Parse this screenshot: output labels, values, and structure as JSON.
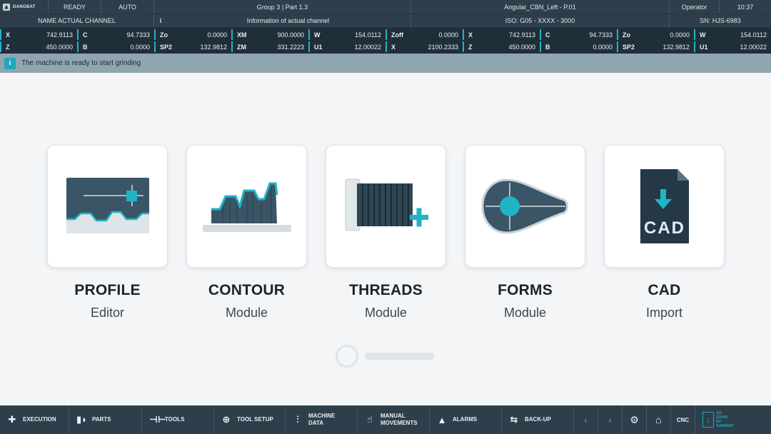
{
  "header": {
    "brand": "DANOBAT",
    "state": "READY",
    "mode": "AUTO",
    "group": "Group 3 | Part 1.3",
    "program": "Angular_CBN_Left - P.01",
    "user": "Operator",
    "time": "10:37",
    "channel_name": "NAME ACTUAL CHANNEL",
    "info_icon": "i",
    "channel_info": "Information of actual channel",
    "iso": "ISO: G05 - XXXX - 3000",
    "serial": "SN: HJS-6983"
  },
  "axes": {
    "row1": [
      {
        "label": "X",
        "value": "742.9113"
      },
      {
        "label": "C",
        "value": "94.7333"
      },
      {
        "label": "Zo",
        "value": "0.0000"
      },
      {
        "label": "XM",
        "value": "900.0000"
      },
      {
        "label": "W",
        "value": "154.0112"
      },
      {
        "label": "Zoff",
        "value": "0.0000"
      },
      {
        "label": "X",
        "value": "742.9113"
      },
      {
        "label": "C",
        "value": "94.7333"
      },
      {
        "label": "Zo",
        "value": "0.0000"
      },
      {
        "label": "W",
        "value": "154.0112"
      }
    ],
    "row2": [
      {
        "label": "Z",
        "value": "450.0000"
      },
      {
        "label": "B",
        "value": "0.0000"
      },
      {
        "label": "SP2",
        "value": "132.9812"
      },
      {
        "label": "ZM",
        "value": "331.2223"
      },
      {
        "label": "U1",
        "value": "12.00022"
      },
      {
        "label": "X",
        "value": "2100.2333"
      },
      {
        "label": "Z",
        "value": "450.0000"
      },
      {
        "label": "B",
        "value": "0.0000"
      },
      {
        "label": "SP2",
        "value": "132.9812"
      },
      {
        "label": "U1",
        "value": "12.00022"
      }
    ]
  },
  "status": {
    "icon": "info-icon",
    "icon_glyph": "i",
    "message": "The machine is ready to start grinding"
  },
  "modules": [
    {
      "title": "PROFILE",
      "subtitle": "Editor",
      "icon": "profile-editor-icon"
    },
    {
      "title": "CONTOUR",
      "subtitle": "Module",
      "icon": "contour-icon"
    },
    {
      "title": "THREADS",
      "subtitle": "Module",
      "icon": "threads-icon"
    },
    {
      "title": "FORMS",
      "subtitle": "Module",
      "icon": "forms-icon"
    },
    {
      "title": "CAD",
      "subtitle": "Import",
      "icon": "cad-import-icon",
      "cad_label": "CAD"
    }
  ],
  "footer": {
    "execution": "EXECUTION",
    "parts": "PARTS",
    "tools": "TOOLS",
    "tool_setup": "TOOL SETUP",
    "machine_data": "MACHINE DATA",
    "manual_movements": "MANUAL MOVEMENTS",
    "alarms": "ALARMS",
    "backup": "BACK-UP",
    "cnc": "CNC",
    "go_grind_1": "GO GRIND",
    "go_grind_2": "BY DANOBAT"
  },
  "colors": {
    "header_bg": "#2e3f4b",
    "axis_bg": "#1f2e39",
    "accent": "#1fb4c6",
    "status_bg": "#8fa5b0",
    "page_bg": "#f3f5f7"
  }
}
